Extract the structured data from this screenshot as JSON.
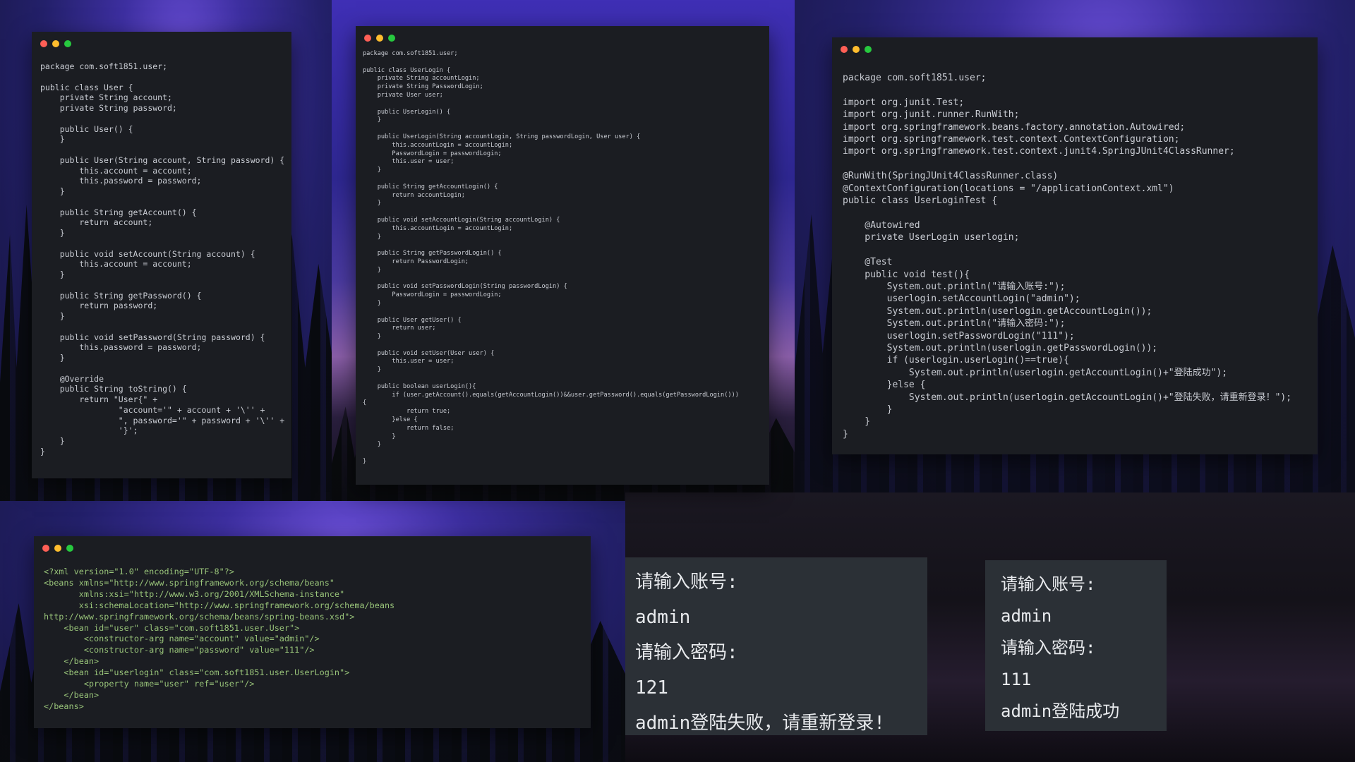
{
  "theme": {
    "keyword": "#e6c07b",
    "access": "#c678dd",
    "type": "#61afef",
    "string": "#e5c07b",
    "text": "#c9ccd3",
    "annotation": "#61afef",
    "xml_tag": "#e06c75",
    "xml_attr": "#d19a66",
    "xml_value": "#98c379"
  },
  "window_controls": [
    "close-dot",
    "minimize-dot",
    "maximize-dot"
  ],
  "panels": {
    "user_java": {
      "code": "package com.soft1851.user;\n\npublic class User {\n    private String account;\n    private String password;\n\n    public User() {\n    }\n\n    public User(String account, String password) {\n        this.account = account;\n        this.password = password;\n    }\n\n    public String getAccount() {\n        return account;\n    }\n\n    public void setAccount(String account) {\n        this.account = account;\n    }\n\n    public String getPassword() {\n        return password;\n    }\n\n    public void setPassword(String password) {\n        this.password = password;\n    }\n\n    @Override\n    public String toString() {\n        return \"User{\" +\n                \"account='\" + account + '\\'' +\n                \", password='\" + password + '\\'' +\n                '}';\n    }\n}"
    },
    "userlogin_java": {
      "code": "package com.soft1851.user;\n\npublic class UserLogin {\n    private String accountLogin;\n    private String PasswordLogin;\n    private User user;\n\n    public UserLogin() {\n    }\n\n    public UserLogin(String accountLogin, String passwordLogin, User user) {\n        this.accountLogin = accountLogin;\n        PasswordLogin = passwordLogin;\n        this.user = user;\n    }\n\n    public String getAccountLogin() {\n        return accountLogin;\n    }\n\n    public void setAccountLogin(String accountLogin) {\n        this.accountLogin = accountLogin;\n    }\n\n    public String getPasswordLogin() {\n        return PasswordLogin;\n    }\n\n    public void setPasswordLogin(String passwordLogin) {\n        PasswordLogin = passwordLogin;\n    }\n\n    public User getUser() {\n        return user;\n    }\n\n    public void setUser(User user) {\n        this.user = user;\n    }\n\n    public boolean userLogin(){\n        if (user.getAccount().equals(getAccountLogin())&&user.getPassword().equals(getPasswordLogin()))\n{\n            return true;\n        }else {\n            return false;\n        }\n    }\n\n}"
    },
    "userlogintest_java": {
      "code": "package com.soft1851.user;\n\nimport org.junit.Test;\nimport org.junit.runner.RunWith;\nimport org.springframework.beans.factory.annotation.Autowired;\nimport org.springframework.test.context.ContextConfiguration;\nimport org.springframework.test.context.junit4.SpringJUnit4ClassRunner;\n\n@RunWith(SpringJUnit4ClassRunner.class)\n@ContextConfiguration(locations = \"/applicationContext.xml\")\npublic class UserLoginTest {\n\n    @Autowired\n    private UserLogin userlogin;\n\n    @Test\n    public void test(){\n        System.out.println(\"请输入账号:\");\n        userlogin.setAccountLogin(\"admin\");\n        System.out.println(userlogin.getAccountLogin());\n        System.out.println(\"请输入密码:\");\n        userlogin.setPasswordLogin(\"111\");\n        System.out.println(userlogin.getPasswordLogin());\n        if (userlogin.userLogin()==true){\n            System.out.println(userlogin.getAccountLogin()+\"登陆成功\");\n        }else {\n            System.out.println(userlogin.getAccountLogin()+\"登陆失败，请重新登录！\");\n        }\n    }\n}"
    },
    "application_context_xml": {
      "code": "<?xml version=\"1.0\" encoding=\"UTF-8\"?>\n<beans xmlns=\"http://www.springframework.org/schema/beans\"\n       xmlns:xsi=\"http://www.w3.org/2001/XMLSchema-instance\"\n       xsi:schemaLocation=\"http://www.springframework.org/schema/beans\nhttp://www.springframework.org/schema/beans/spring-beans.xsd\">\n    <bean id=\"user\" class=\"com.soft1851.user.User\">\n        <constructor-arg name=\"account\" value=\"admin\"/>\n        <constructor-arg name=\"password\" value=\"111\"/>\n    </bean>\n    <bean id=\"userlogin\" class=\"com.soft1851.user.UserLogin\">\n        <property name=\"user\" ref=\"user\"/>\n    </bean>\n</beans>"
    }
  },
  "console_failure": {
    "lines": [
      "请输入账号:",
      "admin",
      "请输入密码:",
      "121",
      "admin登陆失败，请重新登录!"
    ]
  },
  "console_success": {
    "lines": [
      "请输入账号:",
      "admin",
      "请输入密码:",
      "111",
      "admin登陆成功"
    ]
  }
}
